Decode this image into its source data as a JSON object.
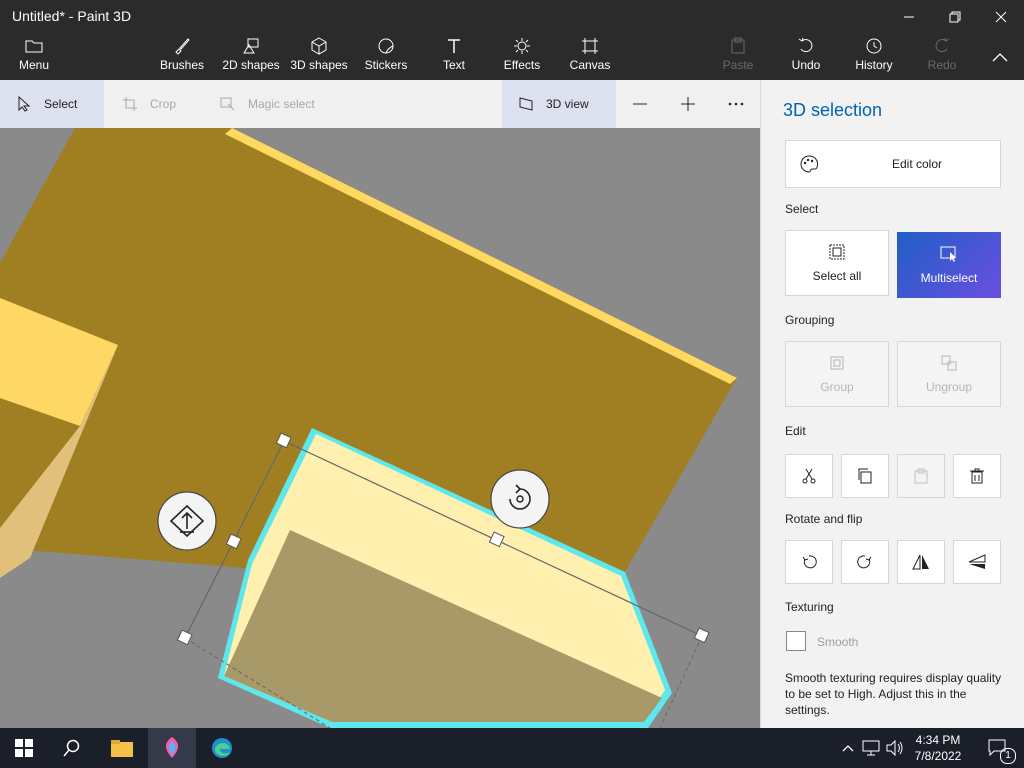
{
  "window": {
    "title": "Untitled* - Paint 3D"
  },
  "ribbon": {
    "menu": "Menu",
    "tools": [
      "Brushes",
      "2D shapes",
      "3D shapes",
      "Stickers",
      "Text",
      "Effects",
      "Canvas"
    ],
    "actions": {
      "paste": "Paste",
      "undo": "Undo",
      "history": "History",
      "redo": "Redo"
    }
  },
  "toolbar": {
    "select": "Select",
    "crop": "Crop",
    "magic_select": "Magic select",
    "view3d": "3D view"
  },
  "panel": {
    "title": "3D selection",
    "edit_color": "Edit color",
    "select_label": "Select",
    "select_all": "Select all",
    "multiselect": "Multiselect",
    "grouping_label": "Grouping",
    "group": "Group",
    "ungroup": "Ungroup",
    "edit_label": "Edit",
    "rotate_label": "Rotate and flip",
    "texturing_label": "Texturing",
    "smooth": "Smooth",
    "note": "Smooth texturing requires display quality to be set to High. Adjust this in the settings."
  },
  "taskbar": {
    "time": "4:34 PM",
    "date": "7/8/2022",
    "notifications": "1"
  },
  "colors": {
    "accent": "#0063b1",
    "object_dark": "#a07f23",
    "object_light": "#fff0b0",
    "selection_outline": "#5ee8ee",
    "canvas_bg": "#8a8a8a"
  }
}
